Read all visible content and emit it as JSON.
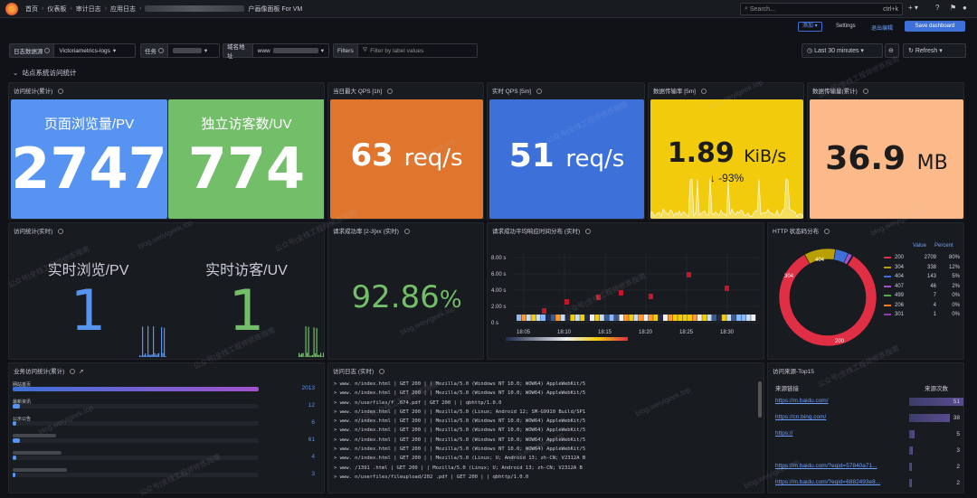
{
  "breadcrumb": [
    "首页",
    "仪表板",
    "审计日志",
    "应用日志",
    "户画像面板 For VM"
  ],
  "search": {
    "placeholder": "Search...",
    "shortcut": "ctrl+k"
  },
  "toolbar": {
    "add_label": "添加",
    "settings_label": "Settings",
    "exit_label": "退出编辑",
    "save_label": "Save dashboard"
  },
  "variables": {
    "datasource_label": "日志数据源",
    "datasource_value": "Victoriametrics-logs",
    "task_label": "任务",
    "domain_label": "域名地址",
    "domain_value": "www",
    "filters_label": "Filters",
    "filters_placeholder": "Filter by label values"
  },
  "time": {
    "range": "Last 30 minutes",
    "refresh": "Refresh"
  },
  "row_title": "站点系统访问统计",
  "panels": {
    "visits_total": {
      "title": "访问统计(累计)",
      "pv_caption": "页面浏览量/PV",
      "pv_value": "2747",
      "uv_caption": "独立访客数/UV",
      "uv_value": "774"
    },
    "max_qps": {
      "title": "当日最大 QPS [1h]",
      "value": "63",
      "unit": "req/s"
    },
    "qps": {
      "title": "实时 QPS [5m]",
      "value": "51",
      "unit": "req/s"
    },
    "transfer_rate": {
      "title": "数据传输率 [5m]",
      "value": "1.89",
      "unit": "KiB/s",
      "delta": "↓ -93%"
    },
    "transfer_total": {
      "title": "数据传输量(累计)",
      "value": "36.9",
      "unit": "MB"
    },
    "visits_realtime": {
      "title": "访问统计(实时)",
      "pv_caption": "实时浏览/PV",
      "pv_value": "1",
      "uv_caption": "实时访客/UV",
      "uv_value": "1"
    },
    "success_rate": {
      "title": "请求成功率 [2-3]xx (实时)",
      "value": "92.86",
      "unit": "%"
    },
    "heatmap": {
      "title": "请求成功平均响应时间分布 (实时)",
      "yticks": [
        "8.00 s",
        "6.00 s",
        "4.00 s",
        "2.00 s",
        "0 s"
      ],
      "xticks": [
        "18:05",
        "18:10",
        "18:15",
        "18:20",
        "18:25",
        "18:30"
      ]
    },
    "http_status": {
      "title": "HTTP 状态码分布",
      "col_value": "Value",
      "col_percent": "Percent",
      "legend": [
        {
          "code": "200",
          "value": "2709",
          "percent": "80%",
          "color": "#e02f44"
        },
        {
          "code": "304",
          "value": "338",
          "percent": "12%",
          "color": "#b8a000"
        },
        {
          "code": "404",
          "value": "143",
          "percent": "5%",
          "color": "#3d71d9"
        },
        {
          "code": "407",
          "value": "46",
          "percent": "2%",
          "color": "#a352cc"
        },
        {
          "code": "499",
          "value": "7",
          "percent": "0%",
          "color": "#56a64b"
        },
        {
          "code": "206",
          "value": "4",
          "percent": "0%",
          "color": "#ff780a"
        },
        {
          "code": "301",
          "value": "1",
          "percent": "0%",
          "color": "#8f3bb8"
        }
      ],
      "slice_labels": {
        "a": "200",
        "b": "304",
        "c": "404"
      }
    },
    "business": {
      "title": "业务访问统计(累计)",
      "rows": [
        {
          "label": "网站首页",
          "value": "2013"
        },
        {
          "label": "最新资讯",
          "value": "12"
        },
        {
          "label": "公示公告",
          "value": "6"
        },
        {
          "label": "",
          "value": "61"
        },
        {
          "label": "",
          "value": "4"
        },
        {
          "label": "",
          "value": "3"
        }
      ]
    },
    "access_log": {
      "title": "访问日志 (实时)",
      "lines": [
        "> www.        n/index.html | GET 200 |  | Mozilla/5.0 (Windows NT 10.0; WOW64) AppleWebKit/5",
        "> www.        n/index.html | GET 200 |  | Mozilla/5.0 (Windows NT 10.0; WOW64) AppleWebKit/5",
        "> www.        n/userfiles/f                     .674.pdf | GET 200 |  | qbhttp/1.0.0",
        "> www.        n/index.html | GET 200 |  | Mozilla/5.0 (Linux; Android 12; SM-G9910 Build/SP1",
        "> www.        n/index.html | GET 200 |  | Mozilla/5.0 (Windows NT 10.0; WOW64) AppleWebKit/5",
        "> www.        n/index.html | GET 200 |  | Mozilla/5.0 (Windows NT 10.0; WOW64) AppleWebKit/5",
        "> www.        n/index.html | GET 200 |  | Mozilla/5.0 (Windows NT 10.0; WOW64) AppleWebKit/5",
        "> www.        n/index.html | GET 200 |  | Mozilla/5.0 (Windows NT 10.0; WOW64) AppleWebKit/5",
        "> www.        n/index.html | GET 200 |  | Mozilla/5.0 (Linux; U; Android 13; zh-CN; V2312A B",
        "> www.        /1391               .html | GET 200 |  | Mozilla/5.0 (Linux; U; Android 13; zh-CN; V2312A B",
        "> www.        n/userfiles/fileupload/202              .pdf | GET 200 |  | qbhttp/1.0.0"
      ]
    },
    "sources": {
      "title": "访问来源-Top15",
      "col_link": "来源链接",
      "col_count": "来源次数",
      "rows": [
        {
          "link": "https://m.baidu.com/",
          "count": "51"
        },
        {
          "link": "https://cn.bing.com/",
          "count": "38"
        },
        {
          "link": "https://",
          "count": "5"
        },
        {
          "link": "",
          "count": "3"
        },
        {
          "link": "https://m.baidu.com/?eqid=57840a71...",
          "count": "2"
        },
        {
          "link": "https://m.baidu.com/?eqid=6882493e8...",
          "count": "2"
        }
      ]
    }
  },
  "watermark": [
    "公众号|全栈工程师修炼指南",
    "blog.weiyigeek.top"
  ]
}
